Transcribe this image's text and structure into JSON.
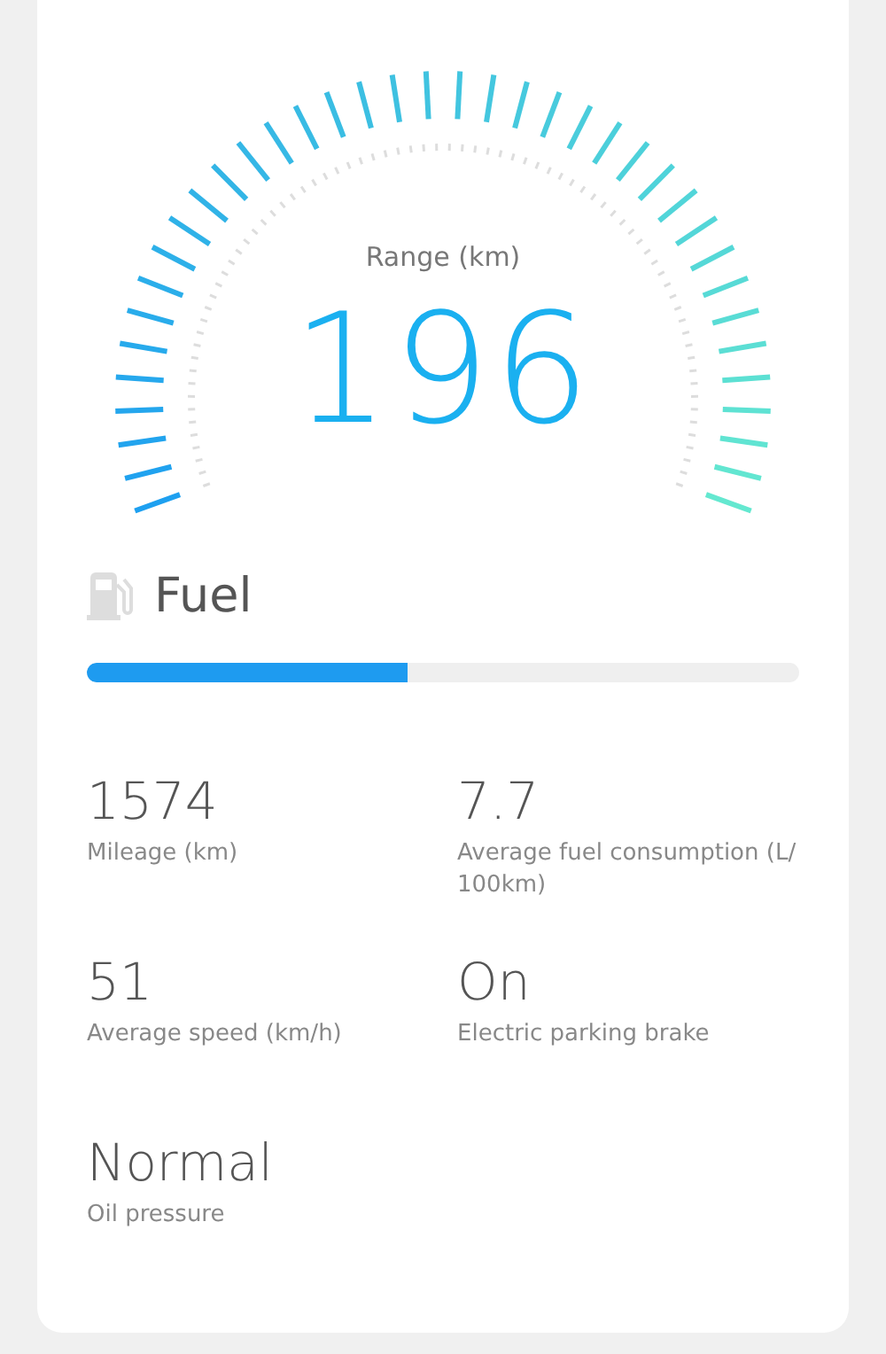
{
  "range": {
    "label": "Range (km)",
    "value": "196"
  },
  "fuel": {
    "label": "Fuel",
    "level": 0.45
  },
  "stats": [
    {
      "value": "1574",
      "label": "Mileage (km)"
    },
    {
      "value": "7.7",
      "label": "Average fuel consumption (L/ 100km)"
    },
    {
      "value": "51",
      "label": "Average speed (km/h)"
    },
    {
      "value": "On",
      "label": "Electric parking brake"
    },
    {
      "value": "Normal",
      "label": "Oil pressure"
    }
  ]
}
